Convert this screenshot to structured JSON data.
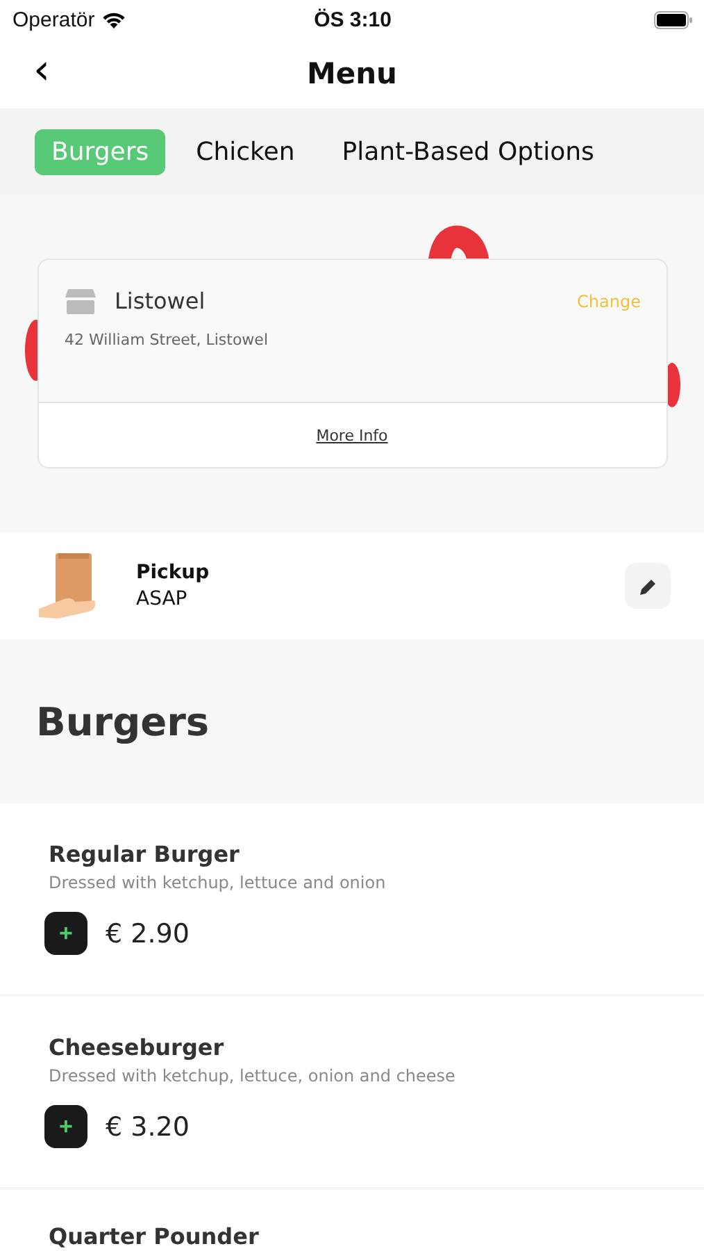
{
  "status_bar": {
    "carrier": "Operatör",
    "time": "ÖS 3:10"
  },
  "nav": {
    "back": "‹",
    "title": "Menu"
  },
  "tabs": [
    {
      "label": "Burgers",
      "selected": true
    },
    {
      "label": "Chicken",
      "selected": false
    },
    {
      "label": "Plant-Based Options",
      "selected": false
    }
  ],
  "store": {
    "name": "Listowel",
    "action": "Change",
    "address": "42 William Street, Listowel",
    "link": "More Info"
  },
  "fulfilment": {
    "mode": "Pickup",
    "time": "ASAP"
  },
  "section": {
    "title": "Burgers"
  },
  "items": [
    {
      "name": "Regular Burger",
      "description": "Dressed with ketchup, lettuce and onion",
      "add": "+",
      "price": "€ 2.90"
    },
    {
      "name": "Cheeseburger",
      "description": "Dressed with ketchup, lettuce, onion and cheese",
      "add": "+",
      "price": "€ 3.20"
    },
    {
      "name": "Quarter Pounder"
    }
  ]
}
